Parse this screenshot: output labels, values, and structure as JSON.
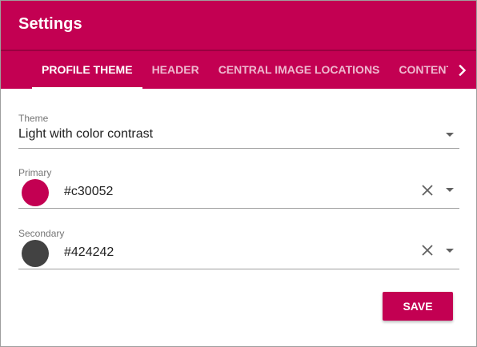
{
  "dialog": {
    "title": "Settings"
  },
  "tabs": [
    {
      "label": "PROFILE THEME",
      "active": true
    },
    {
      "label": "HEADER",
      "active": false
    },
    {
      "label": "CENTRAL IMAGE LOCATIONS",
      "active": false
    },
    {
      "label": "CONTENT HEA",
      "active": false
    }
  ],
  "fields": {
    "theme": {
      "label": "Theme",
      "value": "Light with color contrast"
    },
    "primary": {
      "label": "Primary",
      "value": "#c30052",
      "swatch_color": "#c30052"
    },
    "secondary": {
      "label": "Secondary",
      "value": "#424242",
      "swatch_color": "#424242"
    }
  },
  "actions": {
    "save_label": "SAVE"
  },
  "colors": {
    "brand": "#c30052",
    "text": "#212121",
    "label": "#757575"
  },
  "icons": {
    "tab_scroll": "chevron-right-icon",
    "dropdown": "arrow-drop-down-icon",
    "clear": "close-icon"
  }
}
